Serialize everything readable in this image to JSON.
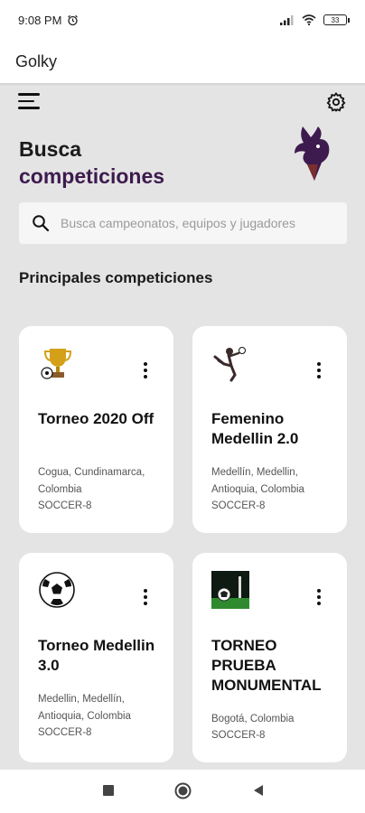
{
  "status": {
    "time": "9:08 PM",
    "battery": "33"
  },
  "app": {
    "title": "Golky"
  },
  "heading": {
    "line1": "Busca",
    "line2": "competiciones"
  },
  "search": {
    "placeholder": "Busca campeonatos, equipos y jugadores"
  },
  "section": {
    "title": "Principales competiciones"
  },
  "competitions": [
    {
      "title": "Torneo 2020 Off",
      "location": "Cogua, Cundinamarca, Colombia",
      "type": "SOCCER-8",
      "icon": "trophy-icon"
    },
    {
      "title": "Femenino Medellin 2.0",
      "location": "Medellín, Medellin, Antioquia, Colombia",
      "type": "SOCCER-8",
      "icon": "player-icon"
    },
    {
      "title": "Torneo Medellin 3.0",
      "location": "Medellin, Medellín, Antioquia, Colombia",
      "type": "SOCCER-8",
      "icon": "soccer-ball-icon"
    },
    {
      "title": "TORNEO PRUEBA MONUMENTAL",
      "location": "Bogotá, Colombia",
      "type": "SOCCER-8",
      "icon": "stadium-photo-icon"
    }
  ],
  "colors": {
    "accent": "#3d1b4e",
    "background": "#e4e4e4",
    "card": "#ffffff"
  }
}
